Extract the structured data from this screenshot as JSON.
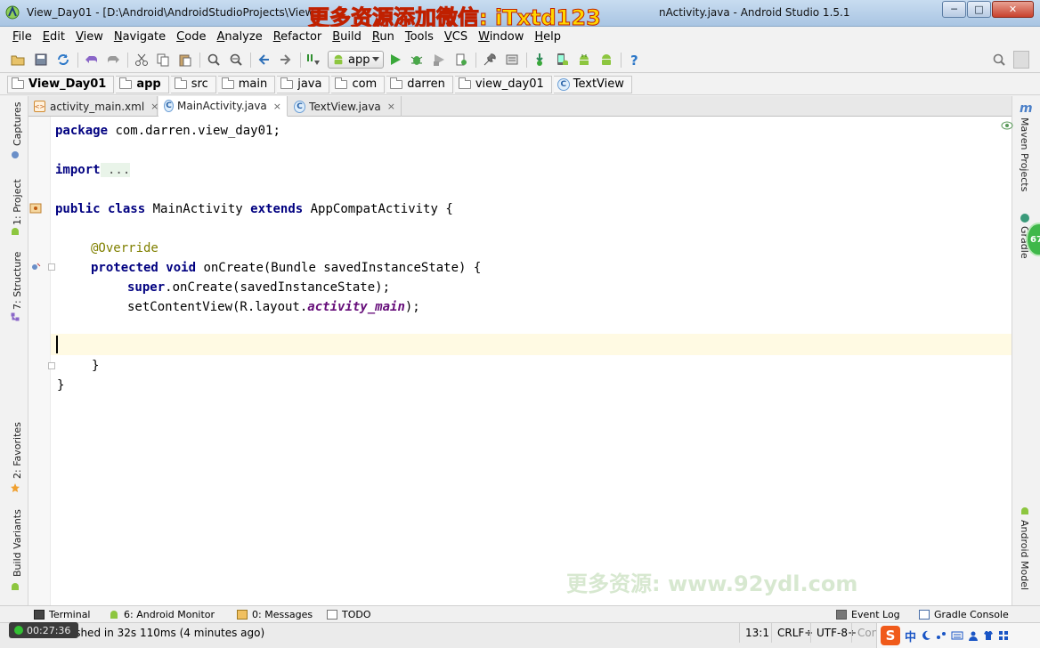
{
  "window": {
    "title_left": "View_Day01 - [D:\\Android\\AndroidStudioProjects\\View_",
    "title_right": "nActivity.java - Android Studio 1.5.1",
    "overlay_text": "更多资源添加微信: iTxtd123",
    "min_label": "─",
    "max_label": "□",
    "close_label": "✕"
  },
  "menu": [
    "File",
    "Edit",
    "View",
    "Navigate",
    "Code",
    "Analyze",
    "Refactor",
    "Build",
    "Run",
    "Tools",
    "VCS",
    "Window",
    "Help"
  ],
  "toolbar": {
    "run_config": "app",
    "icons": [
      "open-folder-icon",
      "save-icon",
      "sync-icon",
      "undo-icon",
      "redo-icon",
      "cut-icon",
      "copy-icon",
      "paste-icon",
      "find-icon",
      "replace-icon",
      "back-icon",
      "forward-icon",
      "make-project-icon",
      "run-icon",
      "debug-icon",
      "coverage-icon",
      "attach-debugger-icon",
      "project-structure-icon",
      "sdk-manager-icon",
      "sync-gradle-icon",
      "avd-manager-icon",
      "device-monitor-icon",
      "android-icon",
      "help-icon"
    ]
  },
  "breadcrumb": [
    "View_Day01",
    "app",
    "src",
    "main",
    "java",
    "com",
    "darren",
    "view_day01",
    "TextView"
  ],
  "tabs": [
    {
      "label": "activity_main.xml",
      "close": "×"
    },
    {
      "label": "MainActivity.java",
      "close": "×"
    },
    {
      "label": "TextView.java",
      "close": "×"
    }
  ],
  "left_tools": [
    "Captures",
    "1: Project",
    "7: Structure",
    "2: Favorites",
    "Build Variants"
  ],
  "right_tools": [
    "Maven Projects",
    "Gradle",
    "Android Model"
  ],
  "right_tools_logo": "m",
  "gradle_badge": "67",
  "code": {
    "l1_kw": "package",
    "l1_rest": " com.darren.view_day01;",
    "l2_kw": "import",
    "l2_fold": " ...",
    "l3_kw1": "public class",
    "l3_mid": " MainActivity ",
    "l3_kw2": "extends",
    "l3_rest": " AppCompatActivity {",
    "l4_ann": "@Override",
    "l5_kw": "protected void",
    "l5_rest": " onCreate(Bundle savedInstanceState) {",
    "l6_kw": "super",
    "l6_rest": ".onCreate(savedInstanceState);",
    "l7_a": "setContentView(R.layout.",
    "l7_field": "activity_main",
    "l7_b": ");",
    "l8": "}",
    "l9": "}"
  },
  "editor_watermark": "更多资源: www.92ydl.com",
  "bottom_tools": {
    "terminal": "Terminal",
    "android_monitor": "6: Android Monitor",
    "messages": "0: Messages",
    "todo": "TODO",
    "event_log": "Event Log",
    "gradle_console": "Gradle Console"
  },
  "status": {
    "timer": "00:27:36",
    "message": "uild finished in 32s 110ms (4 minutes ago)",
    "position": "13:1",
    "line_sep": "CRLF÷",
    "encoding": "UTF-8÷",
    "context": "Con"
  },
  "ime": {
    "logo": "S",
    "lang": "中"
  },
  "colors": {
    "keyword": "#000080",
    "annotation": "#808000",
    "field": "#660e7a",
    "current_line": "#fffae3",
    "watermark_yellow": "#ffd600"
  }
}
